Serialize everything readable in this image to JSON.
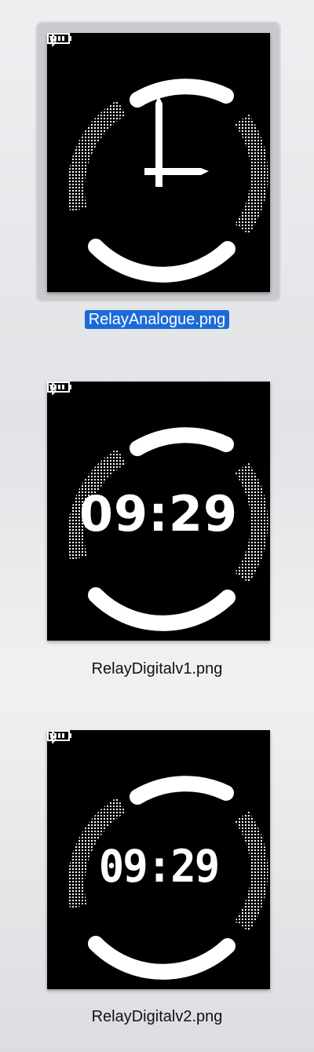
{
  "files": [
    {
      "filename": "RelayAnalogue.png",
      "selected": true,
      "face": "analogue",
      "time": ""
    },
    {
      "filename": "RelayDigitalv1.png",
      "selected": false,
      "face": "digital-v1",
      "time": "09:29"
    },
    {
      "filename": "RelayDigitalv2.png",
      "selected": false,
      "face": "digital-v2",
      "time": "09:29"
    }
  ],
  "status_icons": [
    "bluetooth-icon",
    "battery-icon"
  ],
  "colors": {
    "selection": "#1c6ad8",
    "screen": "#000000",
    "ink": "#ffffff"
  }
}
